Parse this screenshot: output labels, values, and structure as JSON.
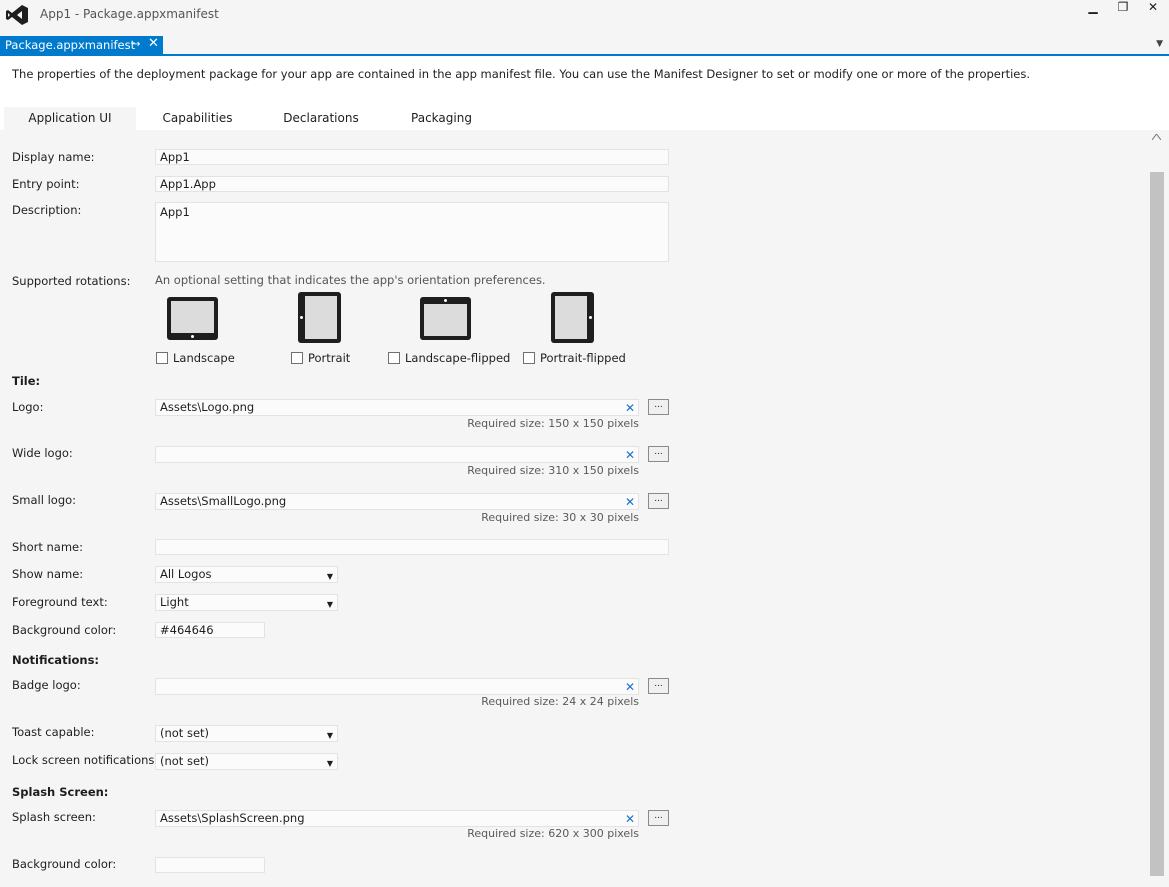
{
  "window": {
    "title": "App1 - Package.appxmanifest",
    "minimize_glyph": "▁",
    "restore_glyph": "❐",
    "close_glyph": "✕"
  },
  "doc_tab": {
    "label": "Package.appxmanifest",
    "pin_glyph": "→",
    "close_glyph": "✕",
    "menu_glyph": "▼"
  },
  "intro_text": "The properties of the deployment package for your app are contained in the app manifest file. You can use the Manifest Designer to set or modify one or more of the properties.",
  "tabs": [
    {
      "label": "Application UI",
      "active": true
    },
    {
      "label": "Capabilities",
      "active": false
    },
    {
      "label": "Declarations",
      "active": false
    },
    {
      "label": "Packaging",
      "active": false
    }
  ],
  "app": {
    "display_name_label": "Display name:",
    "display_name": "App1",
    "entry_point_label": "Entry point:",
    "entry_point": "App1.App",
    "description_label": "Description:",
    "description": "App1"
  },
  "rotations": {
    "label": "Supported rotations:",
    "hint": "An optional setting that indicates the app's orientation preferences.",
    "options": [
      {
        "label": "Landscape",
        "checked": false
      },
      {
        "label": "Portrait",
        "checked": false
      },
      {
        "label": "Landscape-flipped",
        "checked": false
      },
      {
        "label": "Portrait-flipped",
        "checked": false
      }
    ]
  },
  "tile": {
    "heading": "Tile:",
    "logo_label": "Logo:",
    "logo_value": "Assets\\Logo.png",
    "logo_req": "Required size: 150 x 150 pixels",
    "wide_logo_label": "Wide logo:",
    "wide_logo_value": "",
    "wide_logo_req": "Required size: 310 x 150 pixels",
    "small_logo_label": "Small logo:",
    "small_logo_value": "Assets\\SmallLogo.png",
    "small_logo_req": "Required size: 30 x 30 pixels",
    "short_name_label": "Short name:",
    "short_name_value": "",
    "show_name_label": "Show name:",
    "show_name_value": "All Logos",
    "fg_text_label": "Foreground text:",
    "fg_text_value": "Light",
    "bg_color_label": "Background color:",
    "bg_color_value": "#464646"
  },
  "notifications": {
    "heading": "Notifications:",
    "badge_logo_label": "Badge logo:",
    "badge_logo_value": "",
    "badge_logo_req": "Required size: 24 x 24 pixels",
    "toast_label": "Toast capable:",
    "toast_value": "(not set)",
    "lock_label": "Lock screen notifications:",
    "lock_value": "(not set)"
  },
  "splash": {
    "heading": "Splash Screen:",
    "splash_label": "Splash screen:",
    "splash_value": "Assets\\SplashScreen.png",
    "splash_req": "Required size: 620 x 300 pixels",
    "bg_color_label": "Background color:",
    "bg_color_value": ""
  },
  "common": {
    "browse_label": "...",
    "clear_glyph": "✕",
    "dropdown_glyph": "▼"
  },
  "colors": {
    "accent": "#007acc",
    "clear_icon": "#1c6fd0"
  }
}
